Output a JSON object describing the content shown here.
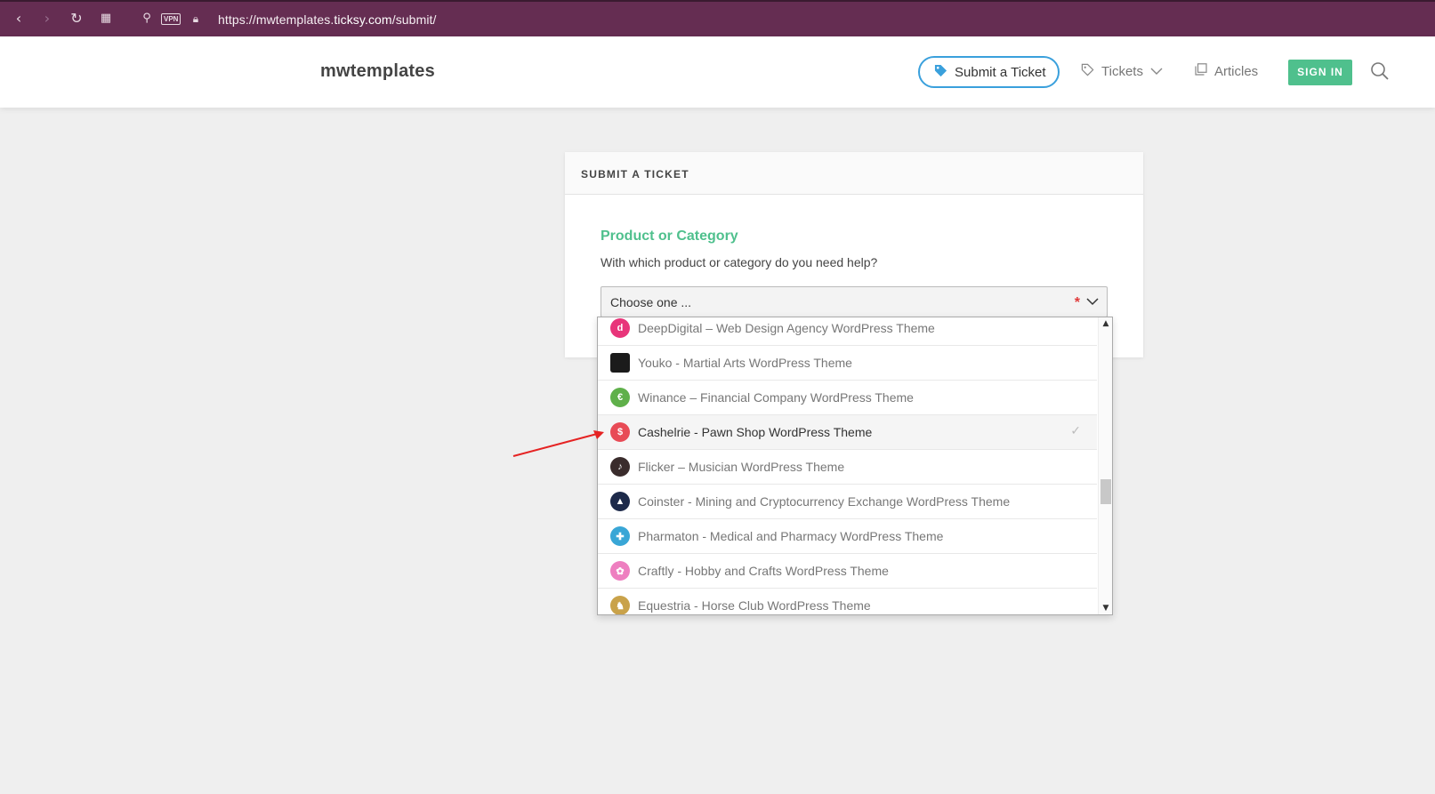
{
  "browser": {
    "back_icon": "chevron-left-icon",
    "forward_icon": "chevron-right-icon",
    "reload_icon": "reload-icon",
    "tabs_icon": "grid-icon",
    "key_icon": "key-icon",
    "vpn_label": "VPN",
    "lock_icon": "lock-icon",
    "url_prefix": "https://mwtemplates.",
    "url_domain": "ticksy.com",
    "url_path": "/submit/"
  },
  "header": {
    "logo": "mwtemplates",
    "submit_ticket": "Submit a Ticket",
    "tickets": "Tickets",
    "articles": "Articles",
    "sign_in": "SIGN IN"
  },
  "card": {
    "heading": "SUBMIT A TICKET",
    "field_title": "Product or Category",
    "field_help": "With which product or category do you need help?",
    "select_value": "Choose one ...",
    "required_mark": "*"
  },
  "dropdown": {
    "items": [
      {
        "label": "DeepDigital – Web Design Agency WordPress Theme",
        "color": "#e8357a",
        "glyph": "d"
      },
      {
        "label": "Youko - Martial Arts WordPress Theme",
        "color": "#1b1b1b",
        "glyph": ""
      },
      {
        "label": "Winance – Financial Company WordPress Theme",
        "color": "#5fb04a",
        "glyph": "€"
      },
      {
        "label": "Cashelrie - Pawn Shop WordPress Theme",
        "color": "#e84b56",
        "glyph": "$",
        "selected": true
      },
      {
        "label": "Flicker – Musician WordPress Theme",
        "color": "#3a2c2c",
        "glyph": "♪"
      },
      {
        "label": "Coinster - Mining and Cryptocurrency Exchange WordPress Theme",
        "color": "#1d2a4a",
        "glyph": "▲"
      },
      {
        "label": "Pharmaton - Medical and Pharmacy WordPress Theme",
        "color": "#39a6d6",
        "glyph": "✚"
      },
      {
        "label": "Craftly - Hobby and Crafts WordPress Theme",
        "color": "#ee7fc0",
        "glyph": "✿"
      },
      {
        "label": "Equestria - Horse Club WordPress Theme",
        "color": "#c9a24a",
        "glyph": "♞"
      }
    ]
  }
}
